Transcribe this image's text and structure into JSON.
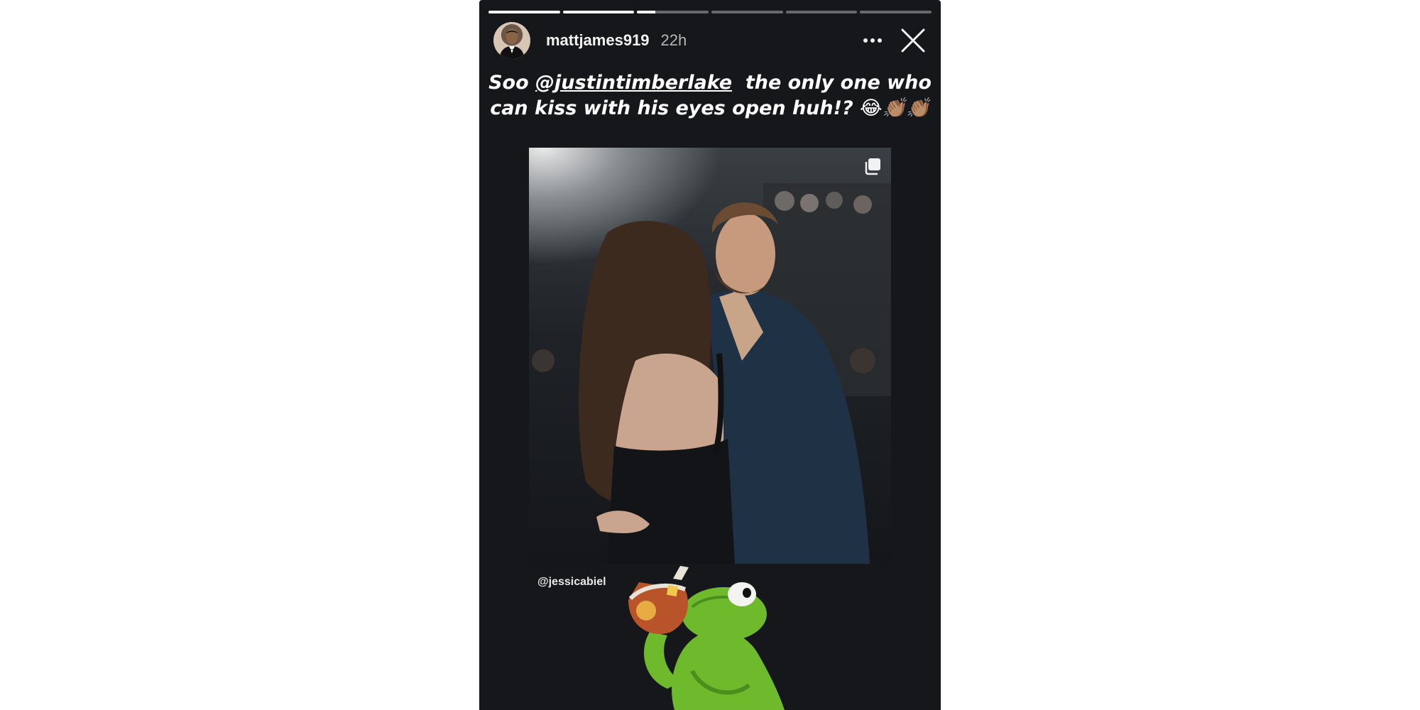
{
  "story": {
    "progress": [
      1,
      1,
      0.25,
      0,
      0,
      0
    ],
    "user": {
      "username": "mattjames919",
      "time": "22h"
    },
    "caption": {
      "prefix": "Soo ",
      "mention": "@justintimberlake",
      "line1_rest": "  the only one who",
      "line2": "can kiss with his eyes open huh!? 😂👏🏽👏🏽"
    },
    "post": {
      "tag": "@jessicabiel"
    },
    "icons": {
      "more": "more-options-icon",
      "close": "close-icon",
      "copy": "multiple-posts-icon"
    },
    "colors": {
      "background": "#16171a",
      "text": "#ffffff",
      "progress": "#f4f4f4",
      "kermit": "#6fba2c"
    }
  }
}
